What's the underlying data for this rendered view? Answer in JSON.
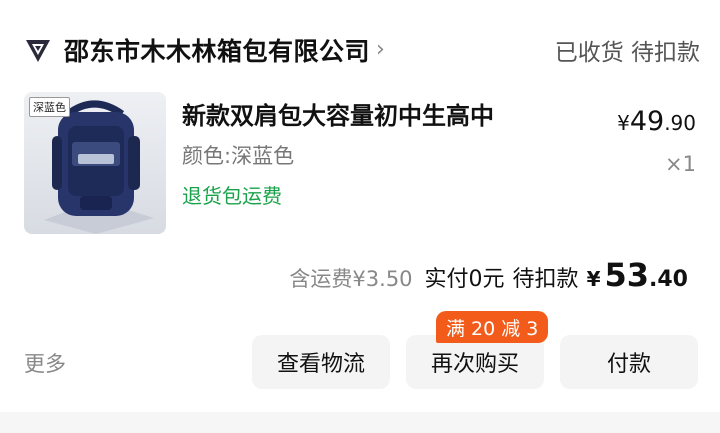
{
  "shop": {
    "name": "邵东市木木林箱包有限公司",
    "chevron": "›",
    "logo_icon": "shop-logo-icon"
  },
  "order_status": "已收货 待扣款",
  "product": {
    "thumbnail_tag": "深蓝色",
    "title": "新款双肩包大容量初中生高中",
    "variant": "颜色:深蓝色",
    "policy": "退货包运费",
    "price": {
      "currency": "¥",
      "integer": "49",
      "decimal": ".90"
    },
    "quantity": "×1",
    "policy_color": "#1aa34a"
  },
  "summary": {
    "shipping": "含运费¥3.50",
    "paid": "实付0元",
    "pending": "待扣款",
    "total": {
      "currency": "¥",
      "integer": "53",
      "decimal": ".40"
    }
  },
  "actions": {
    "more": "更多",
    "logistics": "查看物流",
    "rebuy": "再次购买",
    "pay": "付款",
    "promo": "满 20 减 3",
    "promo_color": "#f25b1a"
  }
}
